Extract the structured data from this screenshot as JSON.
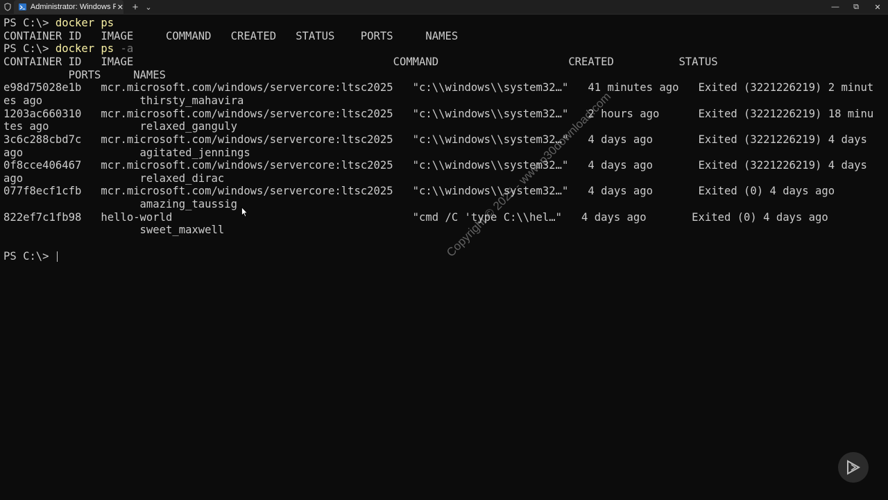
{
  "window": {
    "tab_title": "Administrator: Windows PowerShell",
    "tab_close": "✕",
    "new_tab": "+",
    "tab_menu": "⌄",
    "minimize": "—",
    "maximize": "⧉",
    "close": "✕"
  },
  "terminal": {
    "lines": [
      {
        "prompt": "PS C:\\> ",
        "command": "docker ps",
        "flag": ""
      },
      {
        "text": "CONTAINER ID   IMAGE     COMMAND   CREATED   STATUS    PORTS     NAMES"
      },
      {
        "prompt": "PS C:\\> ",
        "command": "docker ps",
        "flag": " -a"
      },
      {
        "text": "CONTAINER ID   IMAGE                                        COMMAND                    CREATED          STATUS"
      },
      {
        "text": "          PORTS     NAMES"
      },
      {
        "text": "e98d75028e1b   mcr.microsoft.com/windows/servercore:ltsc2025   \"c:\\\\windows\\\\system32…\"   41 minutes ago   Exited (3221226219) 2 minut"
      },
      {
        "text": "es ago               thirsty_mahavira"
      },
      {
        "text": "1203ac660310   mcr.microsoft.com/windows/servercore:ltsc2025   \"c:\\\\windows\\\\system32…\"   2 hours ago      Exited (3221226219) 18 minu"
      },
      {
        "text": "tes ago              relaxed_ganguly"
      },
      {
        "text": "3c6c288cbd7c   mcr.microsoft.com/windows/servercore:ltsc2025   \"c:\\\\windows\\\\system32…\"   4 days ago       Exited (3221226219) 4 days"
      },
      {
        "text": "ago                  agitated_jennings"
      },
      {
        "text": "0f8cce406467   mcr.microsoft.com/windows/servercore:ltsc2025   \"c:\\\\windows\\\\system32…\"   4 days ago       Exited (3221226219) 4 days"
      },
      {
        "text": "ago                  relaxed_dirac"
      },
      {
        "text": "077f8ecf1cfb   mcr.microsoft.com/windows/servercore:ltsc2025   \"c:\\\\windows\\\\system32…\"   4 days ago       Exited (0) 4 days ago"
      },
      {
        "text": "                     amazing_taussig"
      },
      {
        "text": "822ef7c1fb98   hello-world                                     \"cmd /C 'type C:\\\\hel…\"   4 days ago       Exited (0) 4 days ago"
      },
      {
        "text": "                     sweet_maxwell"
      },
      {
        "text": ""
      },
      {
        "prompt": "PS C:\\> ",
        "command": "",
        "flag": "",
        "cursor": true
      }
    ]
  },
  "overlay": {
    "watermark": "Copyright © 2025 - www.p30download.com"
  },
  "icons": {
    "shield": "shield-icon",
    "powershell": "powershell-icon",
    "mouse": "mouse-pointer-icon",
    "play": "play-badge-icon"
  }
}
